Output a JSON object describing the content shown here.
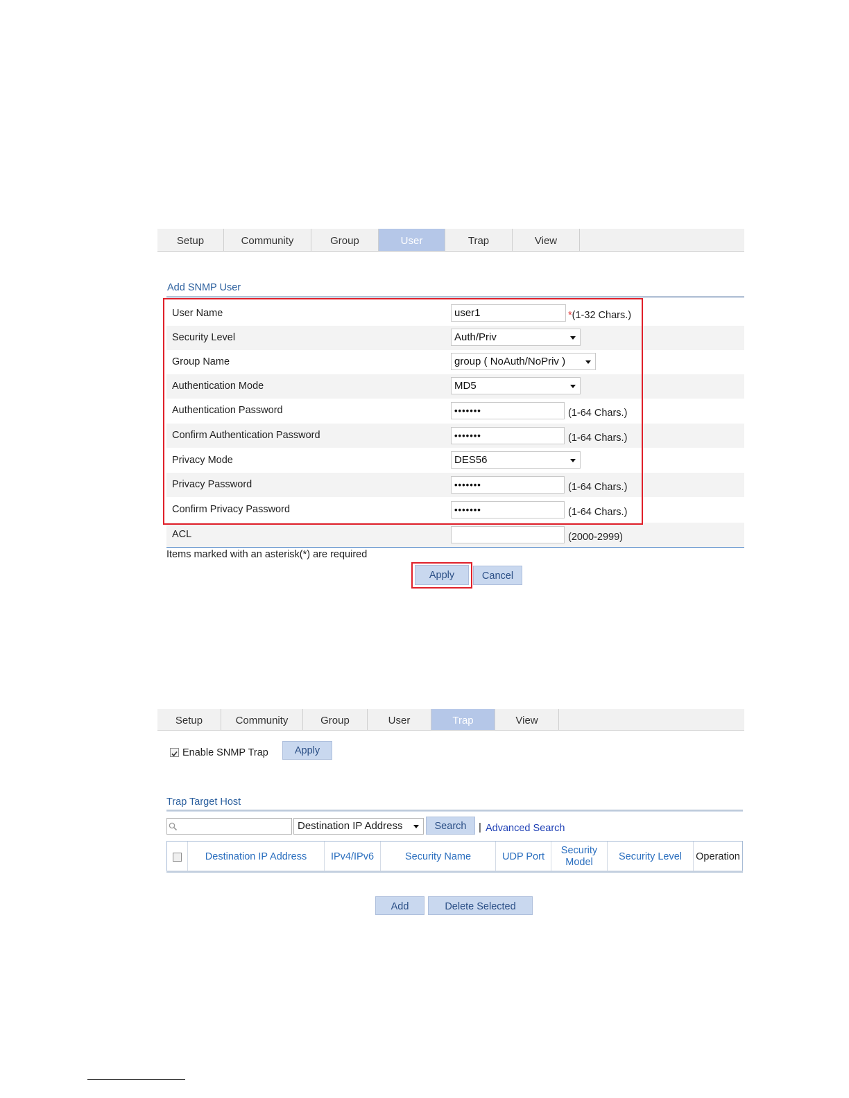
{
  "user_page": {
    "tabs": [
      "Setup",
      "Community",
      "Group",
      "User",
      "Trap",
      "View"
    ],
    "active_tab": "User",
    "section_title": "Add SNMP User",
    "fields": {
      "user_name": {
        "label": "User Name",
        "value": "user1",
        "hint_star": "*",
        "hint": "(1-32 Chars.)"
      },
      "security_level": {
        "label": "Security Level",
        "value": "Auth/Priv"
      },
      "group_name": {
        "label": "Group Name",
        "value": "group ( NoAuth/NoPriv )"
      },
      "auth_mode": {
        "label": "Authentication Mode",
        "value": "MD5"
      },
      "auth_password": {
        "label": "Authentication Password",
        "value": "•••••••",
        "hint": "(1-64 Chars.)"
      },
      "confirm_auth_password": {
        "label": "Confirm Authentication Password",
        "value": "•••••••",
        "hint": "(1-64 Chars.)"
      },
      "privacy_mode": {
        "label": "Privacy Mode",
        "value": "DES56"
      },
      "privacy_password": {
        "label": "Privacy Password",
        "value": "•••••••",
        "hint": "(1-64 Chars.)"
      },
      "confirm_privacy_password": {
        "label": "Confirm Privacy Password",
        "value": "•••••••",
        "hint": "(1-64 Chars.)"
      },
      "acl": {
        "label": "ACL",
        "value": "",
        "hint": "(2000-2999)"
      }
    },
    "required_note": "Items marked with an asterisk(*) are required",
    "apply_label": "Apply",
    "cancel_label": "Cancel"
  },
  "trap_page": {
    "tabs": [
      "Setup",
      "Community",
      "Group",
      "User",
      "Trap",
      "View"
    ],
    "active_tab": "Trap",
    "enable_label": "Enable SNMP Trap",
    "enable_checked": true,
    "apply_label": "Apply",
    "section_title": "Trap Target Host",
    "search": {
      "value": "",
      "field_select": "Destination IP Address",
      "search_label": "Search",
      "separator": "|",
      "advanced_label": "Advanced Search"
    },
    "columns": [
      "Destination IP Address",
      "IPv4/IPv6",
      "Security Name",
      "UDP Port",
      "Security Model",
      "Security Level",
      "Operation"
    ],
    "add_label": "Add",
    "delete_label": "Delete Selected"
  }
}
